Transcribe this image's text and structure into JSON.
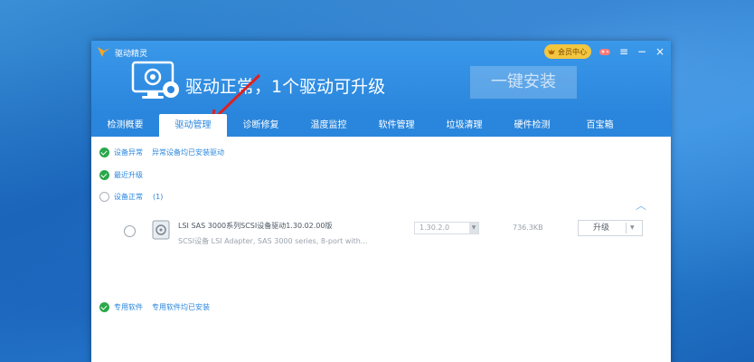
{
  "window": {
    "app_name": "驱动精灵",
    "vip_label": "会员中心",
    "controls": [
      "gamepad-icon",
      "menu-icon",
      "minimize-icon",
      "close-icon"
    ]
  },
  "hero": {
    "status_text": "驱动正常，1个驱动可升级",
    "install_button": "一键安装"
  },
  "tabs": [
    {
      "label": "检测概要"
    },
    {
      "label": "驱动管理",
      "active": true
    },
    {
      "label": "诊断修复"
    },
    {
      "label": "温度监控"
    },
    {
      "label": "软件管理"
    },
    {
      "label": "垃圾清理"
    },
    {
      "label": "硬件检测"
    },
    {
      "label": "百宝箱"
    }
  ],
  "sections": {
    "abnormal": {
      "label": "设备异常",
      "sub": "异常设备均已安装驱动"
    },
    "recent": {
      "label": "最近升级"
    },
    "normal": {
      "label": "设备正常",
      "count": "(1)"
    },
    "software": {
      "label": "专用软件",
      "sub": "专用软件均已安装"
    }
  },
  "driver": {
    "name": "LSI SAS 3000系列SCSI设备驱动1.30.02.00版",
    "desc": "SCSI设备    LSI Adapter, SAS 3000 series, 8-port with...",
    "version": "1.30.2.0",
    "size": "736.3KB",
    "action": "升级"
  },
  "colors": {
    "accent": "#2a86dc",
    "ok": "#2aa84a",
    "vip": "#f3c640"
  }
}
